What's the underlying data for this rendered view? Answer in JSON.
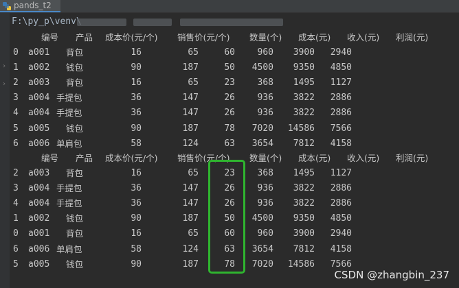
{
  "tab": {
    "title": "pands_t2"
  },
  "command": "F:\\py_p\\venv\\",
  "header1": [
    "编号",
    "产品",
    "成本价(元/个)",
    "销售价(元/个)",
    "数量(个)",
    "成本(元)",
    "收入(元)",
    "利润(元)"
  ],
  "rows1": [
    [
      "0",
      "a001",
      "背包",
      "16",
      "65",
      "60",
      "960",
      "3900",
      "2940"
    ],
    [
      "1",
      "a002",
      "钱包",
      "90",
      "187",
      "50",
      "4500",
      "9350",
      "4850"
    ],
    [
      "2",
      "a003",
      "背包",
      "16",
      "65",
      "23",
      "368",
      "1495",
      "1127"
    ],
    [
      "3",
      "a004",
      "手提包",
      "36",
      "147",
      "26",
      "936",
      "3822",
      "2886"
    ],
    [
      "4",
      "a004",
      "手提包",
      "36",
      "147",
      "26",
      "936",
      "3822",
      "2886"
    ],
    [
      "5",
      "a005",
      "钱包",
      "90",
      "187",
      "78",
      "7020",
      "14586",
      "7566"
    ],
    [
      "6",
      "a006",
      "单肩包",
      "58",
      "124",
      "63",
      "3654",
      "7812",
      "4158"
    ]
  ],
  "header2": [
    "编号",
    "产品",
    "成本价(元/个)",
    "销售价(元/个)",
    "数量(个)",
    "成本(元)",
    "收入(元)",
    "利润(元)"
  ],
  "rows2": [
    [
      "2",
      "a003",
      "背包",
      "16",
      "65",
      "23",
      "368",
      "1495",
      "1127"
    ],
    [
      "3",
      "a004",
      "手提包",
      "36",
      "147",
      "26",
      "936",
      "3822",
      "2886"
    ],
    [
      "4",
      "a004",
      "手提包",
      "36",
      "147",
      "26",
      "936",
      "3822",
      "2886"
    ],
    [
      "1",
      "a002",
      "钱包",
      "90",
      "187",
      "50",
      "4500",
      "9350",
      "4850"
    ],
    [
      "0",
      "a001",
      "背包",
      "16",
      "65",
      "60",
      "960",
      "3900",
      "2940"
    ],
    [
      "6",
      "a006",
      "单肩包",
      "58",
      "124",
      "63",
      "3654",
      "7812",
      "4158"
    ],
    [
      "5",
      "a005",
      "钱包",
      "90",
      "187",
      "78",
      "7020",
      "14586",
      "7566"
    ]
  ],
  "watermark": "CSDN @zhangbin_237",
  "colors": {
    "highlight": "#2fb52f",
    "background": "#2b2b2b",
    "text": "#c8c8c8"
  }
}
